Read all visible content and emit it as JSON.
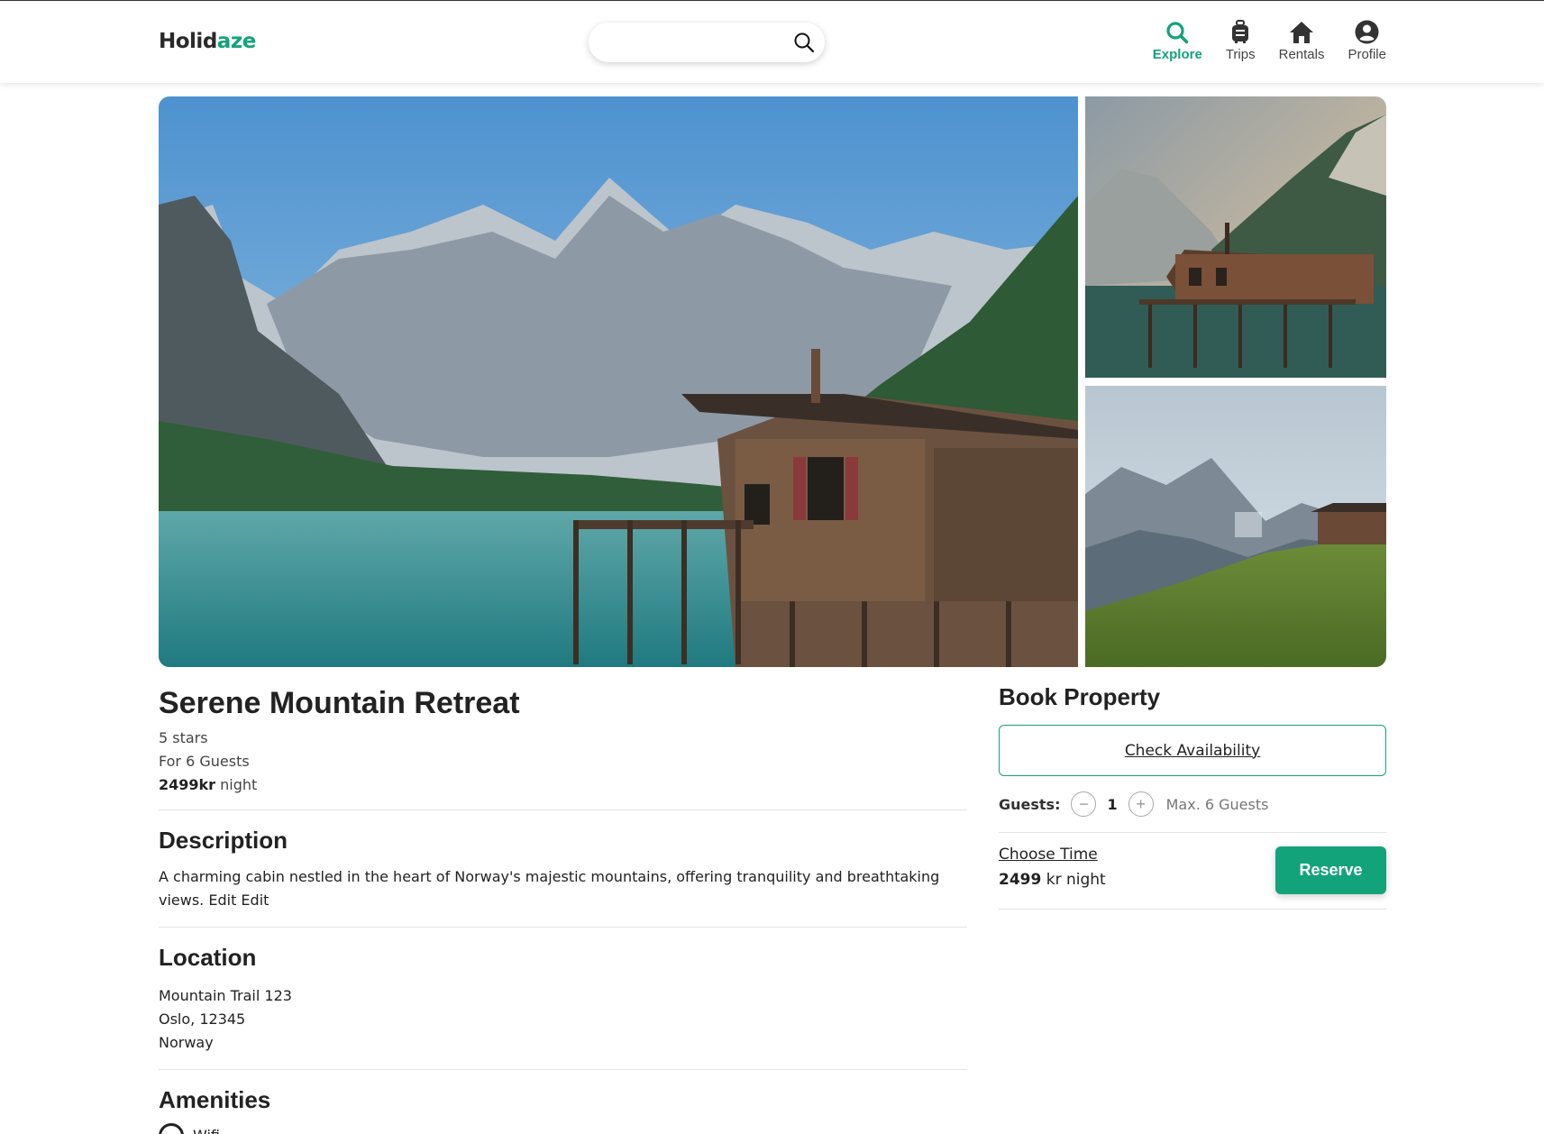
{
  "header": {
    "logo_part1": "Holid",
    "logo_part2": "aze",
    "search": {
      "value": "",
      "placeholder": ""
    },
    "nav": [
      {
        "label": "Explore",
        "icon": "search-icon",
        "active": true
      },
      {
        "label": "Trips",
        "icon": "luggage-icon",
        "active": false
      },
      {
        "label": "Rentals",
        "icon": "home-icon",
        "active": false
      },
      {
        "label": "Profile",
        "icon": "user-circle-icon",
        "active": false
      }
    ]
  },
  "gallery": {
    "main": "lake-cabin-photo",
    "side1": "stilt-cabin-photo",
    "side2": "hillside-cabin-photo"
  },
  "property": {
    "title": "Serene Mountain Retreat",
    "rating": "5 stars",
    "guests": "For 6 Guests",
    "price_bold": "2499kr",
    "price_unit": " night"
  },
  "description": {
    "heading": "Description",
    "text": "A charming cabin nestled in the heart of Norway's majestic mountains, offering tranquility and breathtaking views. Edit Edit"
  },
  "location": {
    "heading": "Location",
    "address": "Mountain Trail 123",
    "city_zip": "Oslo, 12345",
    "country": "Norway"
  },
  "amenities": {
    "heading": "Amenities",
    "items": [
      "Wifi"
    ]
  },
  "booking": {
    "heading": "Book Property",
    "check_availability": "Check Availability",
    "guests_label": "Guests:",
    "minus": "−",
    "plus": "+",
    "guest_count": "1",
    "max_guests": "Max. 6 Guests",
    "choose_time": "Choose Time",
    "price_bold": "2499",
    "price_unit": " kr night",
    "reserve": "Reserve"
  },
  "colors": {
    "accent": "#13a37a",
    "text": "#222222",
    "divider": "#e4e4e4"
  }
}
